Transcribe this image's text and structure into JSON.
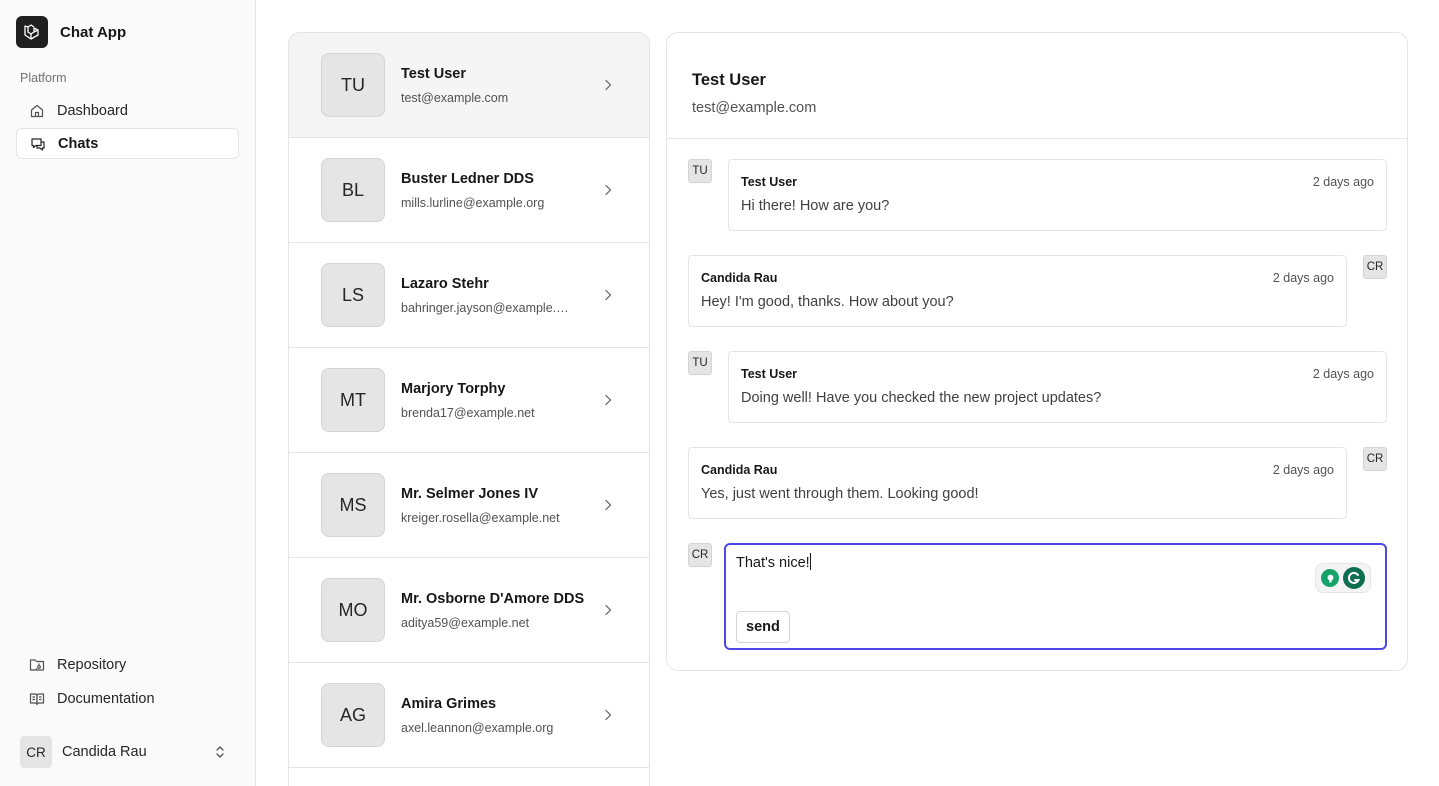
{
  "app": {
    "name": "Chat App"
  },
  "sidebar": {
    "group_label": "Platform",
    "nav": [
      {
        "label": "Dashboard",
        "icon": "home-icon"
      },
      {
        "label": "Chats",
        "icon": "chat-icon",
        "active": true
      }
    ],
    "footer_links": [
      {
        "label": "Repository",
        "icon": "folder-git-icon"
      },
      {
        "label": "Documentation",
        "icon": "book-icon"
      }
    ],
    "user": {
      "initials": "CR",
      "name": "Candida Rau"
    }
  },
  "contacts": [
    {
      "initials": "TU",
      "name": "Test User",
      "email": "test@example.com",
      "active": true
    },
    {
      "initials": "BL",
      "name": "Buster Ledner DDS",
      "email": "mills.lurline@example.org"
    },
    {
      "initials": "LS",
      "name": "Lazaro Stehr",
      "email": "bahringer.jayson@example.com"
    },
    {
      "initials": "MT",
      "name": "Marjory Torphy",
      "email": "brenda17@example.net"
    },
    {
      "initials": "MS",
      "name": "Mr. Selmer Jones IV",
      "email": "kreiger.rosella@example.net"
    },
    {
      "initials": "MO",
      "name": "Mr. Osborne D'Amore DDS",
      "email": "aditya59@example.net"
    },
    {
      "initials": "AG",
      "name": "Amira Grimes",
      "email": "axel.leannon@example.org"
    }
  ],
  "chat": {
    "title": "Test User",
    "subtitle": "test@example.com",
    "messages": [
      {
        "initials": "TU",
        "author": "Test User",
        "time": "2 days ago",
        "text": "Hi there! How are you?",
        "side": "left"
      },
      {
        "initials": "CR",
        "author": "Candida Rau",
        "time": "2 days ago",
        "text": "Hey! I'm good, thanks. How about you?",
        "side": "right"
      },
      {
        "initials": "TU",
        "author": "Test User",
        "time": "2 days ago",
        "text": "Doing well! Have you checked the new project updates?",
        "side": "left"
      },
      {
        "initials": "CR",
        "author": "Candida Rau",
        "time": "2 days ago",
        "text": "Yes, just went through them. Looking good!",
        "side": "right"
      }
    ],
    "composer": {
      "initials": "CR",
      "value": "That's nice!",
      "send_label": "send"
    }
  },
  "colors": {
    "focus_ring": "#4f46e5",
    "grammar_green": "#15a36b",
    "grammar_dark": "#0f6e4f"
  }
}
